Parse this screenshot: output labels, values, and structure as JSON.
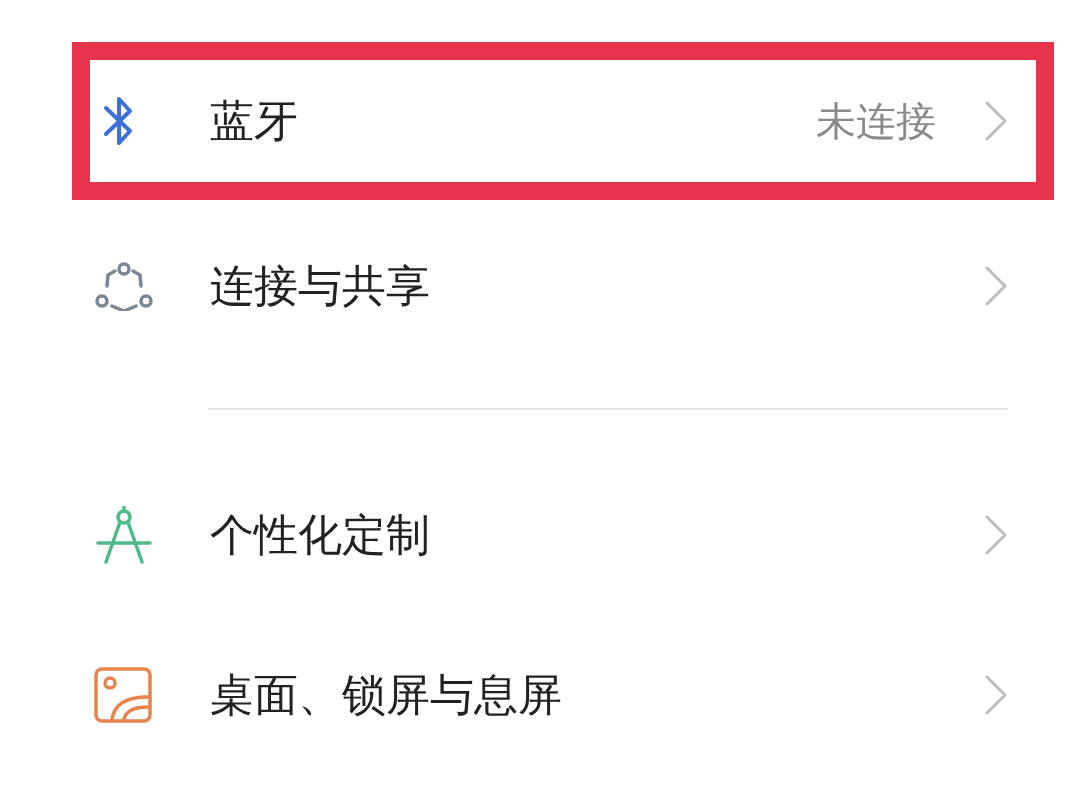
{
  "groups": [
    {
      "items": [
        {
          "label": "蓝牙",
          "value": "未连接",
          "highlighted": true
        },
        {
          "label": "连接与共享",
          "highlighted": false
        }
      ]
    },
    {
      "items": [
        {
          "label": "个性化定制",
          "highlighted": false
        },
        {
          "label": "桌面、锁屏与息屏",
          "highlighted": false
        }
      ]
    }
  ]
}
